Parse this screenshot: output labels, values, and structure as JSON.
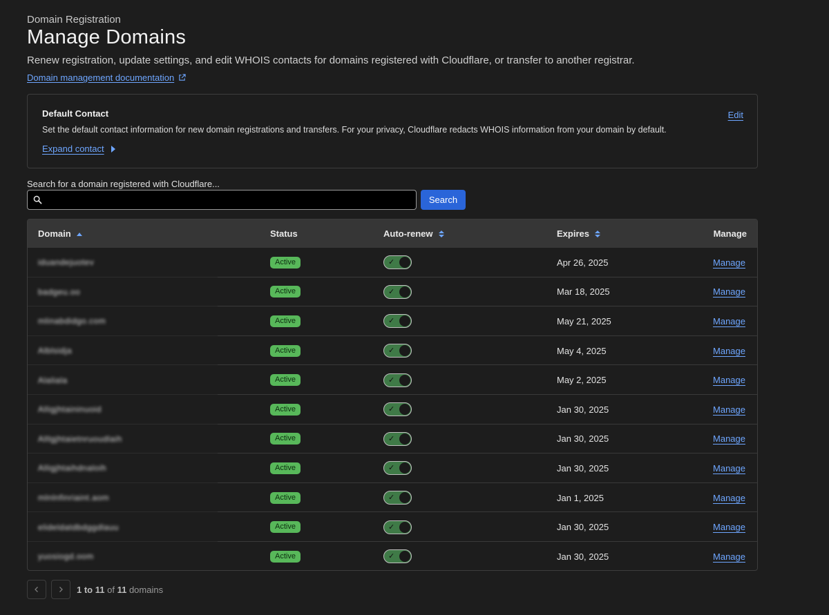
{
  "header": {
    "eyebrow": "Domain Registration",
    "title": "Manage Domains",
    "description": "Renew registration, update settings, and edit WHOIS contacts for domains registered with Cloudflare, or transfer to another registrar.",
    "doc_link": "Domain management documentation"
  },
  "contact": {
    "title": "Default Contact",
    "text": "Set the default contact information for new domain registrations and transfers. For your privacy, Cloudflare redacts WHOIS information from your domain by default.",
    "expand_label": "Expand contact",
    "edit_label": "Edit"
  },
  "search": {
    "label": "Search for a domain registered with Cloudflare...",
    "value": "",
    "placeholder": "",
    "button_label": "Search"
  },
  "table": {
    "columns": {
      "domain": "Domain",
      "status": "Status",
      "autorenew": "Auto-renew",
      "expires": "Expires",
      "manage": "Manage"
    },
    "rows": [
      {
        "domain": "iduandejuotev",
        "status": "Active",
        "expires": "Apr 26, 2025",
        "manage": "Manage",
        "autorenew": true
      },
      {
        "domain": "badgeu.oo",
        "status": "Active",
        "expires": "Mar 18, 2025",
        "manage": "Manage",
        "autorenew": true
      },
      {
        "domain": "mlinabdidgo.com",
        "status": "Active",
        "expires": "May 21, 2025",
        "manage": "Manage",
        "autorenew": true
      },
      {
        "domain": "Alblsidja",
        "status": "Active",
        "expires": "May 4, 2025",
        "manage": "Manage",
        "autorenew": true
      },
      {
        "domain": "Alaliala",
        "status": "Active",
        "expires": "May 2, 2025",
        "manage": "Manage",
        "autorenew": true
      },
      {
        "domain": "Alligjhtaininuoid",
        "status": "Active",
        "expires": "Jan 30, 2025",
        "manage": "Manage",
        "autorenew": true
      },
      {
        "domain": "Alllgjhtaietnruoudlaih",
        "status": "Active",
        "expires": "Jan 30, 2025",
        "manage": "Manage",
        "autorenew": true
      },
      {
        "domain": "Alligjhtaihdnaloih",
        "status": "Active",
        "expires": "Jan 30, 2025",
        "manage": "Manage",
        "autorenew": true
      },
      {
        "domain": "mlnlnfinriaint.aom",
        "status": "Active",
        "expires": "Jan 1, 2025",
        "manage": "Manage",
        "autorenew": true
      },
      {
        "domain": "elideldatdbdggdlauu",
        "status": "Active",
        "expires": "Jan 30, 2025",
        "manage": "Manage",
        "autorenew": true
      },
      {
        "domain": "yuosiogd.oom",
        "status": "Active",
        "expires": "Jan 30, 2025",
        "manage": "Manage",
        "autorenew": true
      }
    ]
  },
  "pagination": {
    "range": "1 to 11",
    "of": "of",
    "total": "11",
    "unit": "domains"
  },
  "colors": {
    "background": "#1d1d1d",
    "link": "#6ea6ff",
    "primary_button": "#2a65d9",
    "active_badge": "#58b85a",
    "toggle_on": "#3f7a47"
  },
  "icons": {
    "external_link": "external-link-icon",
    "search": "search-icon",
    "sort_asc": "sort-ascending-icon",
    "sort": "sort-icon",
    "prev": "chevron-left-icon",
    "next": "chevron-right-icon"
  }
}
